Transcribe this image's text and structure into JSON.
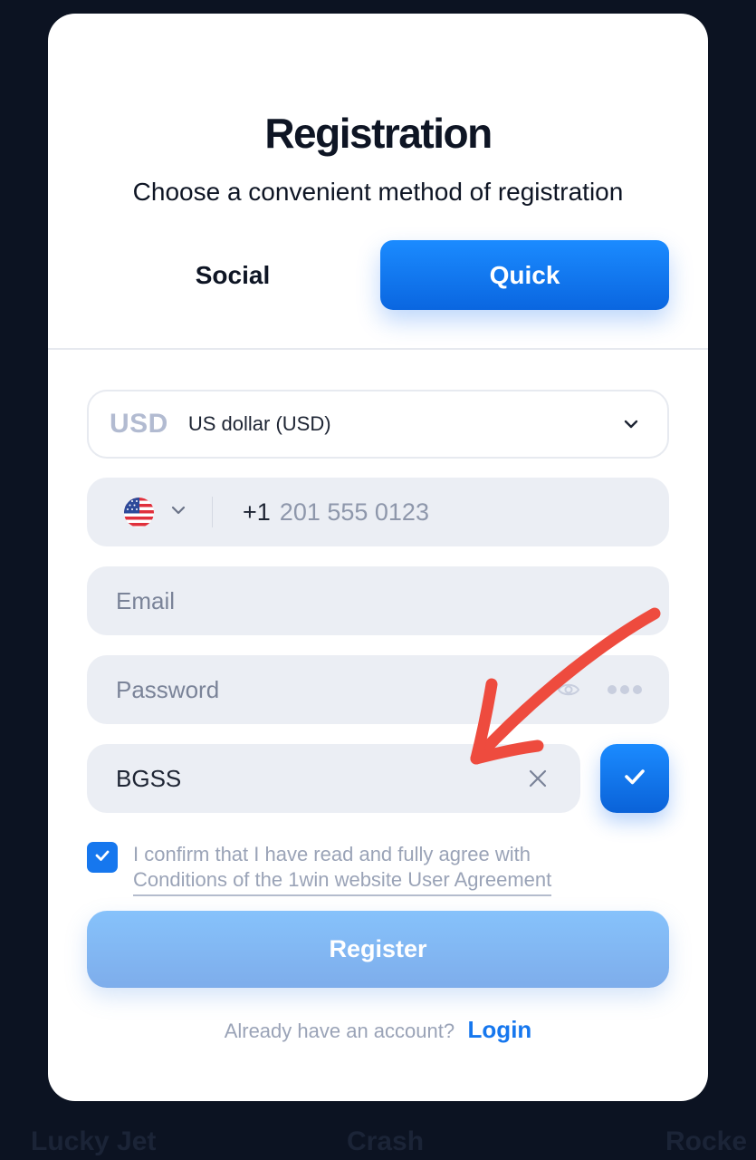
{
  "background": {
    "labels": [
      "Lucky Jet",
      "Crash",
      "Rocke"
    ]
  },
  "modal": {
    "title": "Registration",
    "subtitle": "Choose a convenient method of registration",
    "tabs": [
      {
        "label": "Social",
        "active": false
      },
      {
        "label": "Quick",
        "active": true
      }
    ],
    "currency": {
      "code": "USD",
      "name": "US dollar (USD)",
      "icon": "chevron-down-icon"
    },
    "phone": {
      "country_flag": "us-flag-icon",
      "country_code": "+1",
      "placeholder": "201 555 0123"
    },
    "email": {
      "placeholder": "Email"
    },
    "password": {
      "placeholder": "Password",
      "icons": [
        "eye-icon",
        "more-dots-icon"
      ]
    },
    "promo": {
      "value": "BGSS",
      "clear_icon": "close-icon",
      "confirm_icon": "check-icon"
    },
    "agreement": {
      "checked": true,
      "text": "I confirm that I have read and fully agree with",
      "link": "Conditions of the 1win website User Agreement"
    },
    "register_label": "Register",
    "login": {
      "question": "Already have an account?",
      "link": "Login"
    }
  },
  "annotation": {
    "type": "arrow",
    "color": "#ee4b3e",
    "icon": "red-arrow-icon"
  },
  "colors": {
    "accent": "#1677ee",
    "register_button": "#86c2fb",
    "field_bg": "#ebeef4",
    "page_bg": "#0c1322"
  }
}
